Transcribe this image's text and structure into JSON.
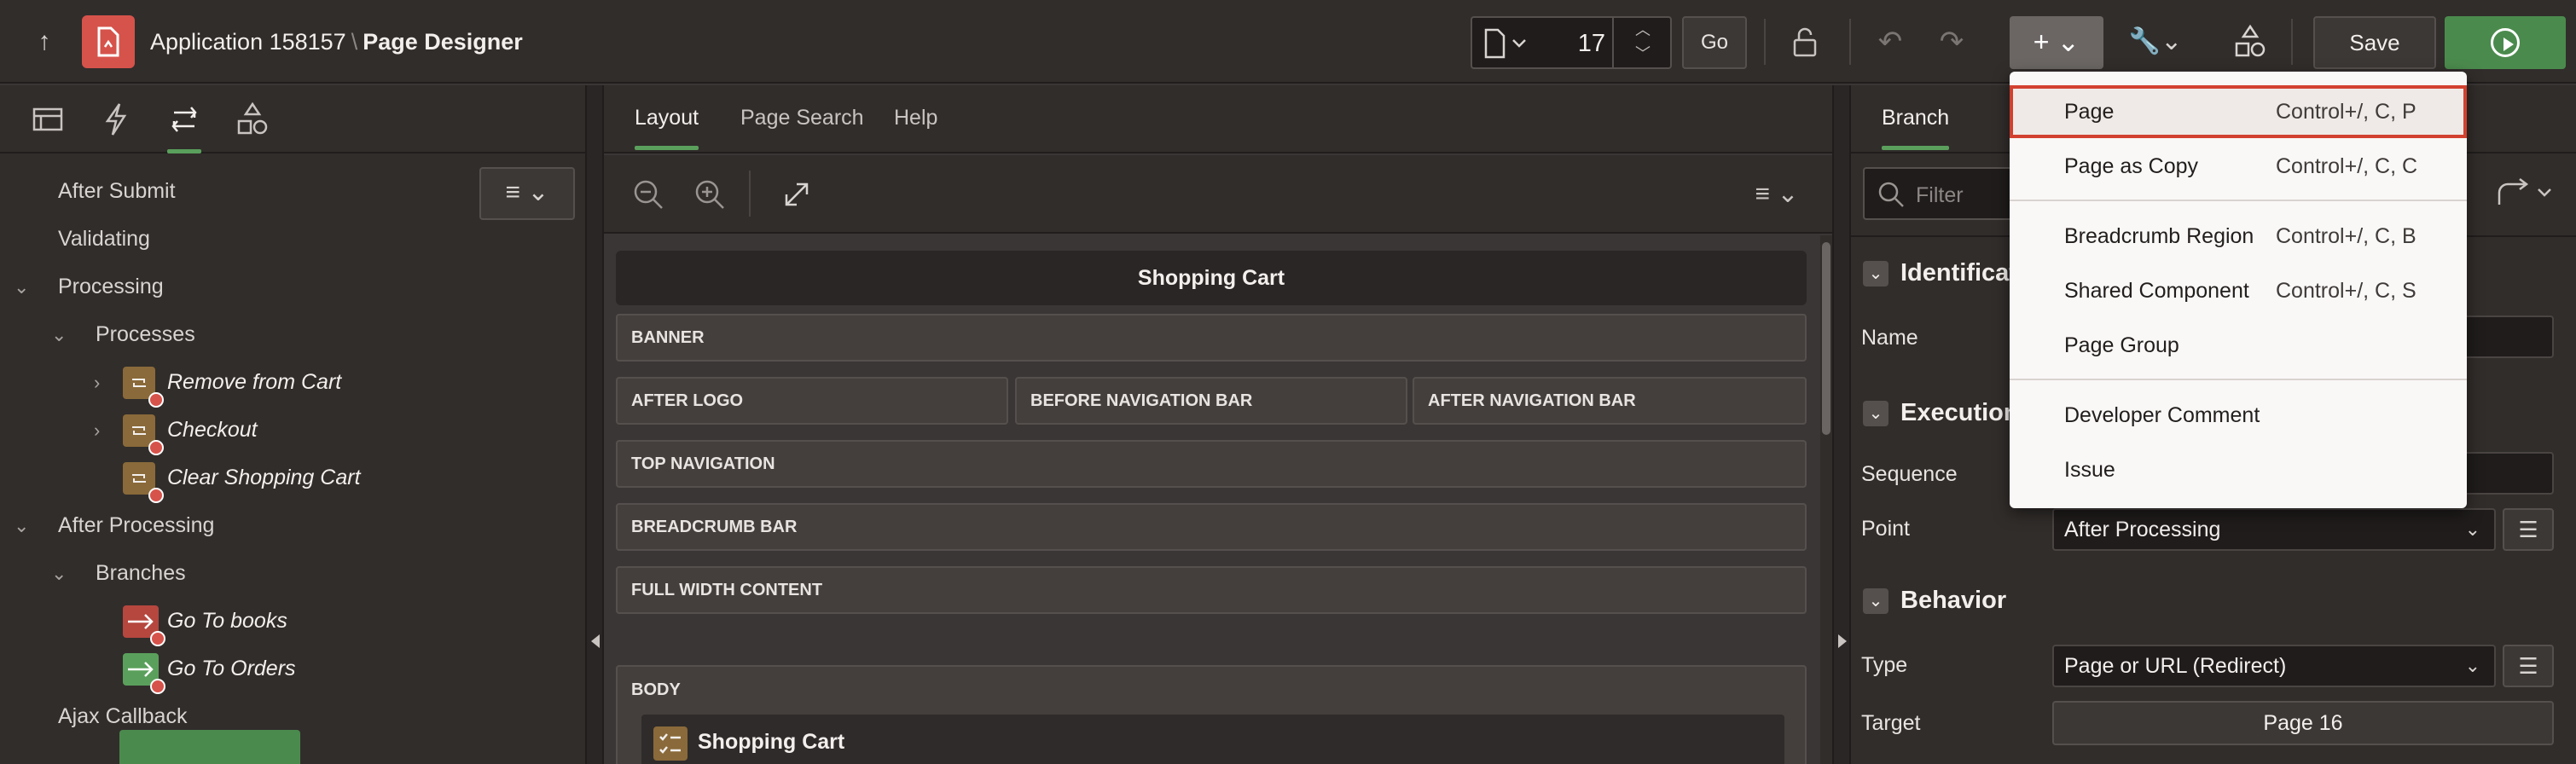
{
  "header": {
    "app_name": "Application 158157",
    "separator": "\\",
    "page_title": "Page Designer",
    "page_number": "17",
    "go_label": "Go",
    "save_label": "Save"
  },
  "left": {
    "tree": [
      {
        "label": "After Submit"
      },
      {
        "label": "Validating"
      },
      {
        "label": "Processing"
      },
      {
        "label": "Processes"
      },
      {
        "label": "Remove from Cart"
      },
      {
        "label": "Checkout"
      },
      {
        "label": "Clear Shopping Cart"
      },
      {
        "label": "After Processing"
      },
      {
        "label": "Branches"
      },
      {
        "label": "Go To books"
      },
      {
        "label": "Go To Orders"
      },
      {
        "label": "Ajax Callback"
      }
    ]
  },
  "center": {
    "tabs": [
      {
        "label": "Layout"
      },
      {
        "label": "Page Search"
      },
      {
        "label": "Help"
      }
    ],
    "page_name": "Shopping Cart",
    "regions": {
      "banner": "BANNER",
      "after_logo": "AFTER LOGO",
      "before_nav": "BEFORE NAVIGATION BAR",
      "after_nav": "AFTER NAVIGATION BAR",
      "top_nav": "TOP NAVIGATION",
      "breadcrumb": "BREADCRUMB BAR",
      "full_width": "FULL WIDTH CONTENT",
      "body": "BODY"
    },
    "body_region_title": "Shopping Cart"
  },
  "right": {
    "tab": "Branch",
    "filter_placeholder": "Filter",
    "sections": {
      "identification": "Identificat",
      "execution": "Execution",
      "behavior": "Behavior"
    },
    "props": {
      "name_label": "Name",
      "sequence_label": "Sequence",
      "point_label": "Point",
      "point_value": "After Processing",
      "type_label": "Type",
      "type_value": "Page or URL (Redirect)",
      "target_label": "Target",
      "target_value": "Page 16"
    }
  },
  "menu": {
    "items": [
      {
        "label": "Page",
        "shortcut": "Control+/, C, P"
      },
      {
        "label": "Page as Copy",
        "shortcut": "Control+/, C, C"
      },
      {
        "label": "Breadcrumb Region",
        "shortcut": "Control+/, C, B"
      },
      {
        "label": "Shared Component",
        "shortcut": "Control+/, C, S"
      },
      {
        "label": "Page Group",
        "shortcut": ""
      },
      {
        "label": "Developer Comment",
        "shortcut": ""
      },
      {
        "label": "Issue",
        "shortcut": ""
      }
    ]
  }
}
